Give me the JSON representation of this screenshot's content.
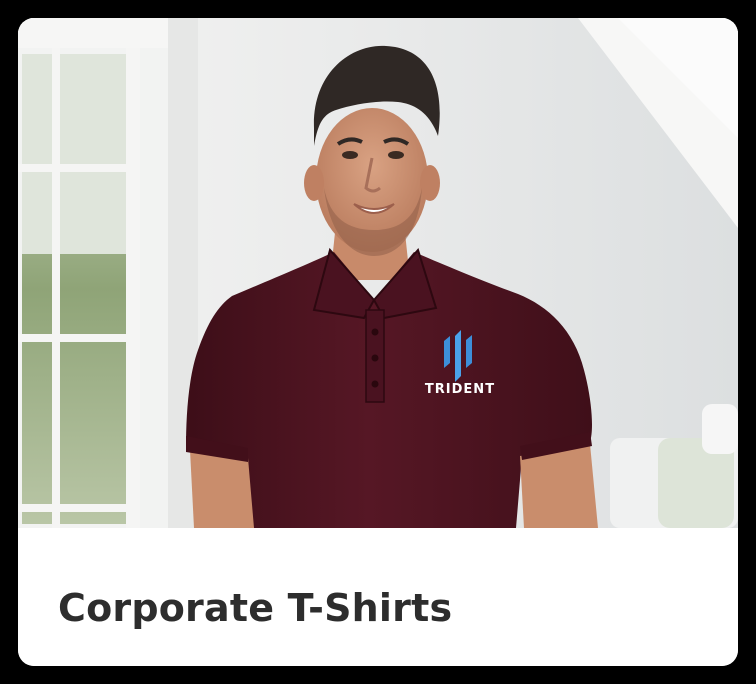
{
  "card": {
    "title": "Corporate T-Shirts",
    "image": {
      "subject": "man-wearing-maroon-polo",
      "logo_text": "TRIDENT"
    }
  },
  "colors": {
    "frame": "#000000",
    "card_bg": "#ffffff",
    "title_text": "#2d2d2d",
    "shirt": "#4e1320",
    "logo_blue": "#3d8fd9",
    "logo_text": "#ffffff"
  }
}
